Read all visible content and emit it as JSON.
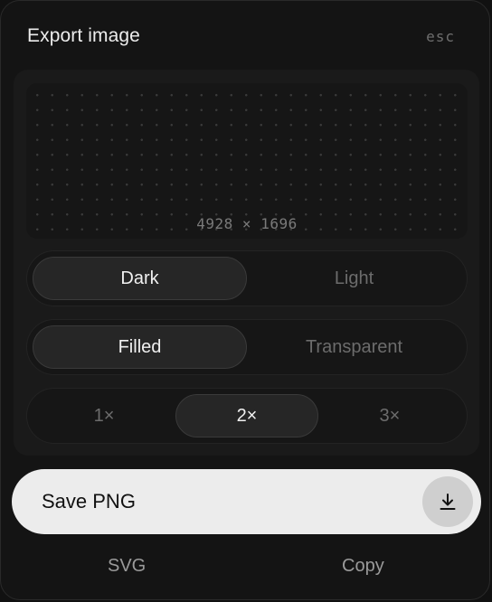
{
  "header": {
    "title": "Export image",
    "close_hint": "esc"
  },
  "preview": {
    "dimensions": "4928 × 1696"
  },
  "theme": {
    "options": [
      "Dark",
      "Light"
    ],
    "selected": "Dark"
  },
  "background": {
    "options": [
      "Filled",
      "Transparent"
    ],
    "selected": "Filled"
  },
  "scale": {
    "options": [
      "1×",
      "2×",
      "3×"
    ],
    "selected": "2×"
  },
  "actions": {
    "save_label": "Save PNG",
    "save_icon": "download-icon",
    "svg_label": "SVG",
    "copy_label": "Copy"
  },
  "colors": {
    "panel_bg": "#141414",
    "active_segment": "#262626",
    "primary_button": "#ececec"
  }
}
